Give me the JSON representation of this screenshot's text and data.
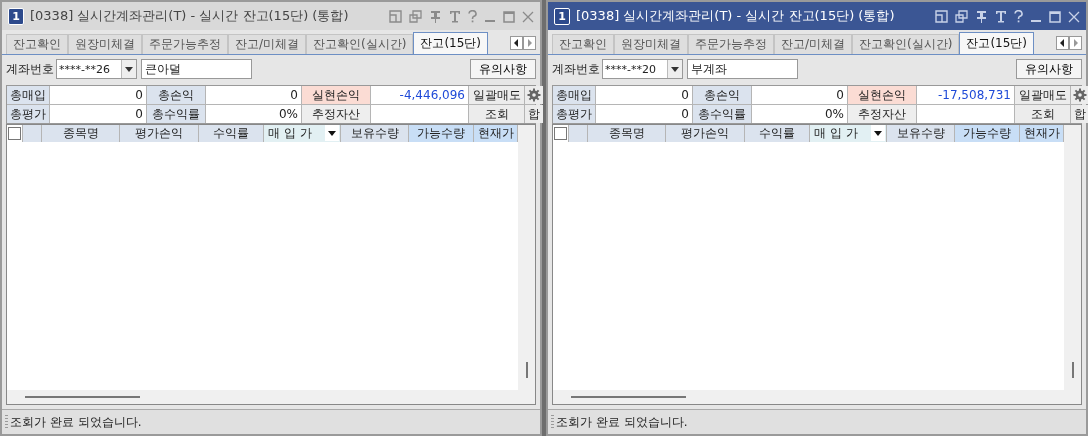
{
  "windows": [
    {
      "active": false,
      "select_all_checked": false,
      "number": "1",
      "title": "[0338] 실시간계좌관리(T) - 실시간 잔고(15단) (통합)",
      "tabs": [
        {
          "label": "잔고확인",
          "selected": false
        },
        {
          "label": "원장미체결",
          "selected": false
        },
        {
          "label": "주문가능추정",
          "selected": false
        },
        {
          "label": "잔고/미체결",
          "selected": false
        },
        {
          "label": "잔고확인(실시간)",
          "selected": false
        },
        {
          "label": "잔고(15단)",
          "selected": true
        }
      ],
      "account": {
        "label": "계좌번호",
        "number": "****-**26",
        "name": "큰아덜"
      },
      "notice_button": "유의사항",
      "summary": [
        {
          "kind": "label",
          "text": "총매입"
        },
        {
          "kind": "value",
          "text": "0"
        },
        {
          "kind": "label",
          "text": "총손익"
        },
        {
          "kind": "value",
          "text": "0"
        },
        {
          "kind": "pink",
          "text": "실현손익"
        },
        {
          "kind": "loss",
          "text": "-4,446,096"
        },
        {
          "kind": "button",
          "text": "일괄매도"
        },
        {
          "kind": "gear"
        },
        {
          "kind": "label",
          "text": "총평가"
        },
        {
          "kind": "value",
          "text": "0"
        },
        {
          "kind": "label",
          "text": "총수익률"
        },
        {
          "kind": "value",
          "text": "0%"
        },
        {
          "kind": "grey",
          "text": "추정자산"
        },
        {
          "kind": "value"
        },
        {
          "kind": "button",
          "text": "조회"
        },
        {
          "kind": "button",
          "text": "합"
        }
      ],
      "columns": [
        {
          "kind": "plain",
          "label": "종목명"
        },
        {
          "kind": "plain",
          "label": "평가손익"
        },
        {
          "kind": "plain",
          "label": "수익률"
        },
        {
          "kind": "sort",
          "label": "매 입 가"
        },
        {
          "kind": "plain",
          "label": "보유수량"
        },
        {
          "kind": "highlight",
          "label": "가능수량"
        },
        {
          "kind": "highlight",
          "label": "현재가"
        }
      ],
      "status": "조회가 완료 되었습니다."
    },
    {
      "active": true,
      "select_all_checked": false,
      "number": "1",
      "title": "[0338] 실시간계좌관리(T) - 실시간 잔고(15단) (통합)",
      "tabs": [
        {
          "label": "잔고확인",
          "selected": false
        },
        {
          "label": "원장미체결",
          "selected": false
        },
        {
          "label": "주문가능추정",
          "selected": false
        },
        {
          "label": "잔고/미체결",
          "selected": false
        },
        {
          "label": "잔고확인(실시간)",
          "selected": false
        },
        {
          "label": "잔고(15단)",
          "selected": true
        }
      ],
      "account": {
        "label": "계좌번호",
        "number": "****-**20",
        "name": "부계좌"
      },
      "notice_button": "유의사항",
      "summary": [
        {
          "kind": "label",
          "text": "총매입"
        },
        {
          "kind": "value",
          "text": "0"
        },
        {
          "kind": "label",
          "text": "총손익"
        },
        {
          "kind": "value",
          "text": "0"
        },
        {
          "kind": "pink",
          "text": "실현손익"
        },
        {
          "kind": "loss",
          "text": "-17,508,731"
        },
        {
          "kind": "button",
          "text": "일괄매도"
        },
        {
          "kind": "gear"
        },
        {
          "kind": "label",
          "text": "총평가"
        },
        {
          "kind": "value",
          "text": "0"
        },
        {
          "kind": "label",
          "text": "총수익률"
        },
        {
          "kind": "value",
          "text": "0%"
        },
        {
          "kind": "grey",
          "text": "추정자산"
        },
        {
          "kind": "value"
        },
        {
          "kind": "button",
          "text": "조회"
        },
        {
          "kind": "button",
          "text": "합"
        }
      ],
      "columns": [
        {
          "kind": "plain",
          "label": "종목명"
        },
        {
          "kind": "plain",
          "label": "평가손익"
        },
        {
          "kind": "plain",
          "label": "수익률"
        },
        {
          "kind": "sort",
          "label": "매 입 가"
        },
        {
          "kind": "plain",
          "label": "보유수량"
        },
        {
          "kind": "highlight",
          "label": "가능수량"
        },
        {
          "kind": "highlight",
          "label": "현재가"
        }
      ],
      "status": "조회가 완료 되었습니다."
    }
  ]
}
